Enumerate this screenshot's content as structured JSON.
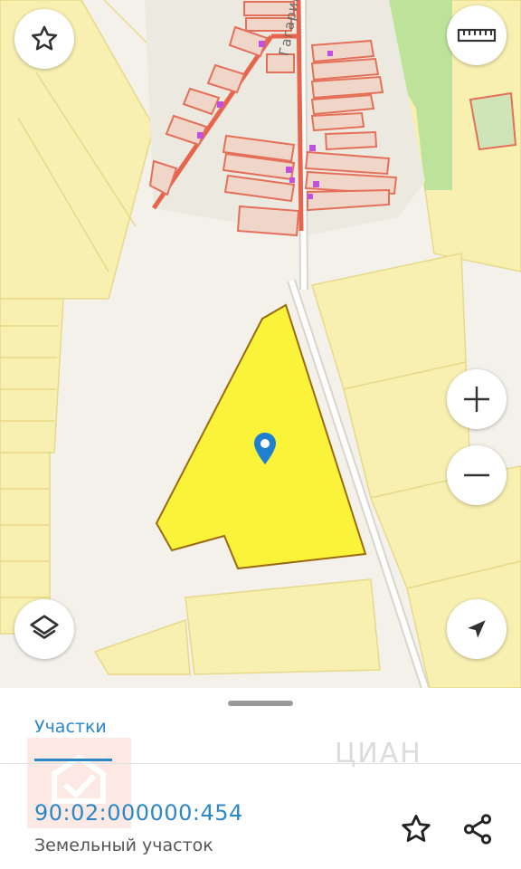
{
  "map": {
    "street_label": "Гагарина ул",
    "colors": {
      "selected_parcel": "#fbf33a",
      "parcel": "#f8f0b0",
      "building_outline": "#e5705a",
      "road": "#e8644d",
      "green_zone": "#bde39a",
      "background": "#f3f1ea"
    },
    "controls": {
      "favorite": "star-icon",
      "ruler": "ruler-icon",
      "zoom_in": "plus-icon",
      "zoom_out": "minus-icon",
      "layers": "layers-icon",
      "my_location": "navigation-arrow-icon"
    }
  },
  "sheet": {
    "tab_label": "Участки",
    "watermark_text": "ЦИАН",
    "parcel": {
      "cadastral_number": "90:02:000000:454",
      "type": "Земельный участок"
    },
    "actions": {
      "favorite": "star-outline-icon",
      "share": "share-icon"
    },
    "accent_color": "#2b87c8"
  }
}
